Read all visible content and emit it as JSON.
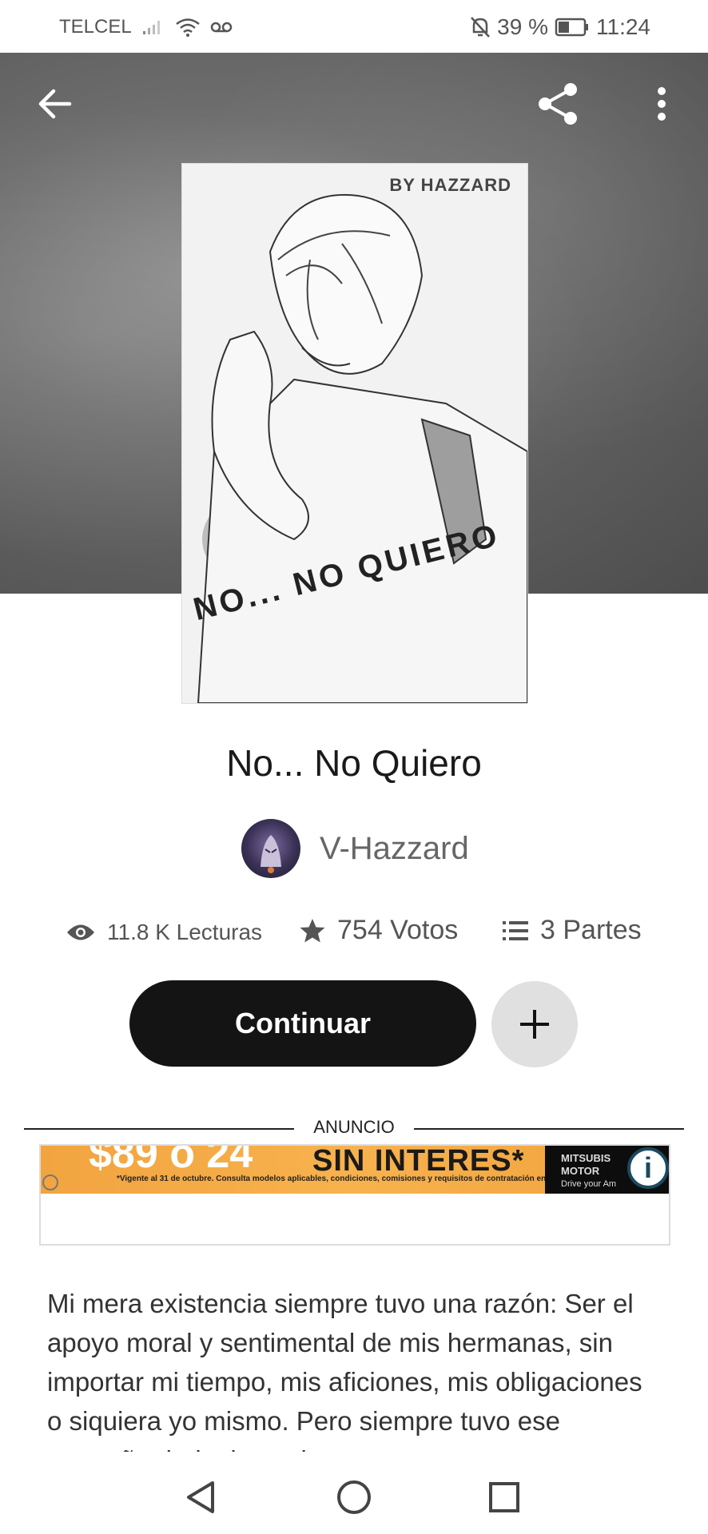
{
  "status_bar": {
    "carrier": "TELCEL",
    "battery_percent": "39 %",
    "time": "11:24"
  },
  "cover": {
    "byline": "BY HAZZARD",
    "title": "NO... NO QUIERO"
  },
  "story": {
    "title": "No... No Quiero",
    "author": "V-Hazzard"
  },
  "stats": {
    "reads": "11.8 K Lecturas",
    "votes": "754 Votos",
    "parts": "3 Partes"
  },
  "actions": {
    "continue_label": "Continuar"
  },
  "ad": {
    "label": "ANUNCIO",
    "headline": "SIN INTERES*",
    "big_text": "$89  o 24",
    "fine_print": "*Vigente al 31 de octubre. Consulta modelos aplicables, condiciones, comisiones y requisitos de contratación en mitsubishi-motors.mx",
    "brand_line1": "MITSUBIS",
    "brand_line2": "MOTOR",
    "brand_line3": "Drive your Am"
  },
  "description": {
    "text": "Mi mera existencia siempre tuvo una razón: Ser el apoyo moral y sentimental de mis hermanas, sin importar mi tiempo, mis aficiones, mis obligaciones o siquiera yo mismo. Pero siempre tuvo ese pequeño duda, la cual"
  },
  "colors": {
    "hero_bg": "#5f5f5f",
    "button_dark": "#141414",
    "add_button_bg": "#e0e0e0",
    "ad_orange": "#f2a43f"
  }
}
